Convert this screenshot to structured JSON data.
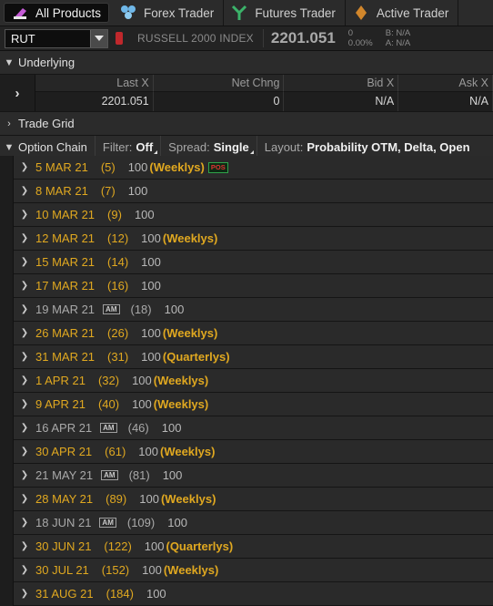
{
  "tabs": [
    {
      "label": "All Products",
      "icon": "all-products-icon",
      "active": true
    },
    {
      "label": "Forex Trader",
      "icon": "forex-icon",
      "active": false
    },
    {
      "label": "Futures Trader",
      "icon": "futures-icon",
      "active": false
    },
    {
      "label": "Active Trader",
      "icon": "active-trader-icon",
      "active": false
    }
  ],
  "symbol": {
    "value": "RUT",
    "name": "RUSSELL 2000 INDEX",
    "price": "2201.051",
    "change": "0",
    "change_pct": "0.00%",
    "bid": "B: N/A",
    "ask": "A: N/A"
  },
  "underlying": {
    "title": "Underlying",
    "columns": [
      {
        "header": "Last X",
        "value": "2201.051"
      },
      {
        "header": "Net Chng",
        "value": "0"
      },
      {
        "header": "Bid X",
        "value": "N/A"
      },
      {
        "header": "Ask X",
        "value": "N/A"
      }
    ]
  },
  "trade_grid": {
    "title": "Trade Grid"
  },
  "option_chain": {
    "title": "Option Chain",
    "filter_label": "Filter:",
    "filter_value": "Off",
    "spread_label": "Spread:",
    "spread_value": "Single",
    "layout_label": "Layout:",
    "layout_value": "Probability OTM, Delta, Open"
  },
  "expirations": [
    {
      "date": "5 MAR 21",
      "days": "(5)",
      "mult": "100",
      "tag": "(Weeklys)",
      "am": false,
      "pos": "POS",
      "highlight": true
    },
    {
      "date": "8 MAR 21",
      "days": "(7)",
      "mult": "100",
      "tag": "",
      "am": false,
      "pos": "",
      "highlight": true
    },
    {
      "date": "10 MAR 21",
      "days": "(9)",
      "mult": "100",
      "tag": "",
      "am": false,
      "pos": "",
      "highlight": true
    },
    {
      "date": "12 MAR 21",
      "days": "(12)",
      "mult": "100",
      "tag": "(Weeklys)",
      "am": false,
      "pos": "",
      "highlight": true
    },
    {
      "date": "15 MAR 21",
      "days": "(14)",
      "mult": "100",
      "tag": "",
      "am": false,
      "pos": "",
      "highlight": true
    },
    {
      "date": "17 MAR 21",
      "days": "(16)",
      "mult": "100",
      "tag": "",
      "am": false,
      "pos": "",
      "highlight": true
    },
    {
      "date": "19 MAR 21",
      "days": "(18)",
      "mult": "100",
      "tag": "",
      "am": true,
      "pos": "",
      "highlight": false
    },
    {
      "date": "26 MAR 21",
      "days": "(26)",
      "mult": "100",
      "tag": "(Weeklys)",
      "am": false,
      "pos": "",
      "highlight": true
    },
    {
      "date": "31 MAR 21",
      "days": "(31)",
      "mult": "100",
      "tag": "(Quarterlys)",
      "am": false,
      "pos": "",
      "highlight": true
    },
    {
      "date": "1 APR 21",
      "days": "(32)",
      "mult": "100",
      "tag": "(Weeklys)",
      "am": false,
      "pos": "",
      "highlight": true
    },
    {
      "date": "9 APR 21",
      "days": "(40)",
      "mult": "100",
      "tag": "(Weeklys)",
      "am": false,
      "pos": "",
      "highlight": true
    },
    {
      "date": "16 APR 21",
      "days": "(46)",
      "mult": "100",
      "tag": "",
      "am": true,
      "pos": "",
      "highlight": false
    },
    {
      "date": "30 APR 21",
      "days": "(61)",
      "mult": "100",
      "tag": "(Weeklys)",
      "am": false,
      "pos": "",
      "highlight": true
    },
    {
      "date": "21 MAY 21",
      "days": "(81)",
      "mult": "100",
      "tag": "",
      "am": true,
      "pos": "",
      "highlight": false
    },
    {
      "date": "28 MAY 21",
      "days": "(89)",
      "mult": "100",
      "tag": "(Weeklys)",
      "am": false,
      "pos": "",
      "highlight": true
    },
    {
      "date": "18 JUN 21",
      "days": "(109)",
      "mult": "100",
      "tag": "",
      "am": true,
      "pos": "",
      "highlight": false
    },
    {
      "date": "30 JUN 21",
      "days": "(122)",
      "mult": "100",
      "tag": "(Quarterlys)",
      "am": false,
      "pos": "",
      "highlight": true
    },
    {
      "date": "30 JUL 21",
      "days": "(152)",
      "mult": "100",
      "tag": "(Weeklys)",
      "am": false,
      "pos": "",
      "highlight": true
    },
    {
      "date": "31 AUG 21",
      "days": "(184)",
      "mult": "100",
      "tag": "",
      "am": false,
      "pos": "",
      "highlight": true
    }
  ],
  "am_label": "AM",
  "colors": {
    "weekly": "#e0a820",
    "standard": "#a9a9a9",
    "pos_border": "#2fa44a"
  }
}
